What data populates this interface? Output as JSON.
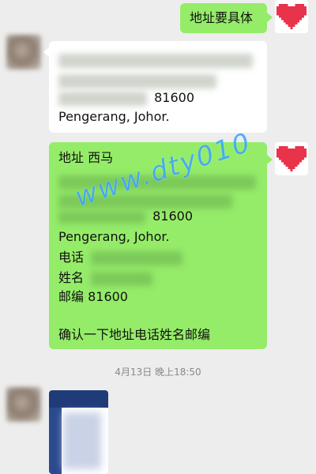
{
  "messages": {
    "m1": {
      "text": "地址要具体"
    },
    "m2": {
      "line_postcode": "81600",
      "line_state": "Pengerang, Johor."
    },
    "m3": {
      "address_label": "地址  西马",
      "postcode_line": "81600",
      "state_line": "Pengerang, Johor.",
      "phone_label": "电话",
      "name_label": "姓名",
      "zip_line": "邮编  81600",
      "confirm": "确认一下地址电话姓名邮编"
    }
  },
  "timestamp": "4月13日  晚上18:50",
  "watermark": "www.dty010",
  "colors": {
    "green_bubble": "#95ec69",
    "heart": "#e8334a",
    "background": "#ededed",
    "watermark": "#3aa3ff"
  },
  "icons": {
    "self_avatar": "heart-icon"
  }
}
